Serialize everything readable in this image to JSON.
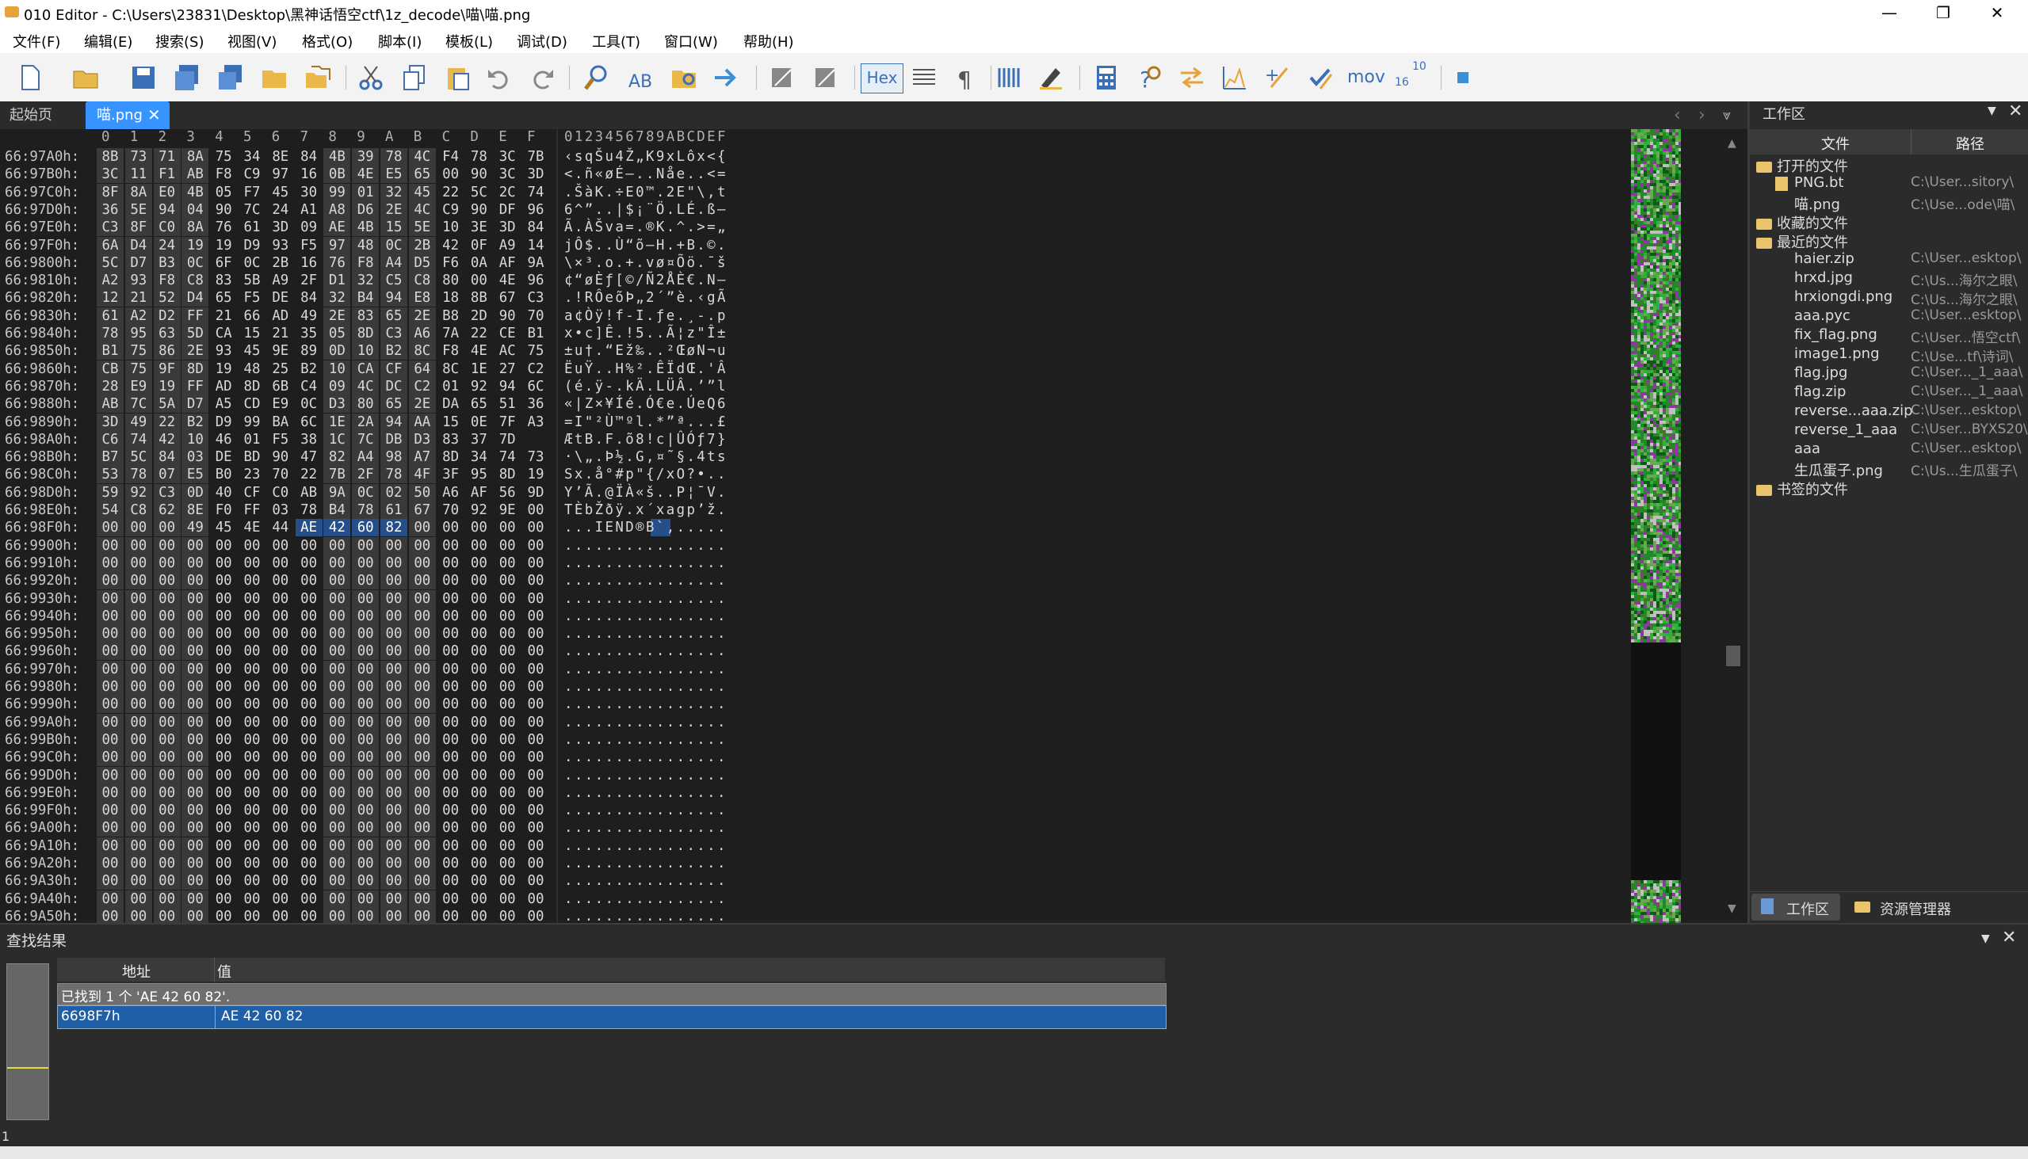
{
  "title": "010 Editor - C:\\Users\\23831\\Desktop\\黑神话悟空ctf\\1z_decode\\喵\\喵.png",
  "window_controls": {
    "minimize": "—",
    "maximize": "❐",
    "close": "✕"
  },
  "menu": [
    "文件(F)",
    "编辑(E)",
    "搜索(S)",
    "视图(V)",
    "格式(O)",
    "脚本(I)",
    "模板(L)",
    "调试(D)",
    "工具(T)",
    "窗口(W)",
    "帮助(H)"
  ],
  "toolbar": {
    "hex_label": "Hex",
    "mov_label": "mov",
    "base_top": "10",
    "base_bottom": "16"
  },
  "tabs": {
    "start": "起始页",
    "file": "喵.png"
  },
  "hex_header": {
    "columns": [
      "0",
      "1",
      "2",
      "3",
      "4",
      "5",
      "6",
      "7",
      "8",
      "9",
      "A",
      "B",
      "C",
      "D",
      "E",
      "F"
    ],
    "ascii": "0123456789ABCDEF"
  },
  "hex_rows": [
    {
      "addr": "66:97A0h:",
      "bytes": [
        "8B",
        "73",
        "71",
        "8A",
        "75",
        "34",
        "8E",
        "84",
        "4B",
        "39",
        "78",
        "4C",
        "F4",
        "78",
        "3C",
        "7B"
      ],
      "ascii": "‹sqŠu4Ž„K9xLôx<{"
    },
    {
      "addr": "66:97B0h:",
      "bytes": [
        "3C",
        "11",
        "F1",
        "AB",
        "F8",
        "C9",
        "97",
        "16",
        "0B",
        "4E",
        "E5",
        "65",
        "00",
        "90",
        "3C",
        "3D"
      ],
      "ascii": "<.ñ«øÉ—..Nåe..<="
    },
    {
      "addr": "66:97C0h:",
      "bytes": [
        "8F",
        "8A",
        "E0",
        "4B",
        "05",
        "F7",
        "45",
        "30",
        "99",
        "01",
        "32",
        "45",
        "22",
        "5C",
        "2C",
        "74"
      ],
      "ascii": ".ŠàK.÷E0™.2E\"\\,t"
    },
    {
      "addr": "66:97D0h:",
      "bytes": [
        "36",
        "5E",
        "94",
        "04",
        "90",
        "7C",
        "24",
        "A1",
        "A8",
        "D6",
        "2E",
        "4C",
        "C9",
        "90",
        "DF",
        "96"
      ],
      "ascii": "6^”..|$¡¨Ö.LÉ.ß–"
    },
    {
      "addr": "66:97E0h:",
      "bytes": [
        "C3",
        "8F",
        "C0",
        "8A",
        "76",
        "61",
        "3D",
        "09",
        "AE",
        "4B",
        "15",
        "5E",
        "10",
        "3E",
        "3D",
        "84"
      ],
      "ascii": "Ã.ÀŠva=.®K.^.>=„"
    },
    {
      "addr": "66:97F0h:",
      "bytes": [
        "6A",
        "D4",
        "24",
        "19",
        "19",
        "D9",
        "93",
        "F5",
        "97",
        "48",
        "0C",
        "2B",
        "42",
        "0F",
        "A9",
        "14"
      ],
      "ascii": "jÔ$..Ù“õ—H.+B.©."
    },
    {
      "addr": "66:9800h:",
      "bytes": [
        "5C",
        "D7",
        "B3",
        "0C",
        "6F",
        "0C",
        "2B",
        "16",
        "76",
        "F8",
        "A4",
        "D5",
        "F6",
        "0A",
        "AF",
        "9A"
      ],
      "ascii": "\\×³.o.+.vø¤Õö.¯š"
    },
    {
      "addr": "66:9810h:",
      "bytes": [
        "A2",
        "93",
        "F8",
        "C8",
        "83",
        "5B",
        "A9",
        "2F",
        "D1",
        "32",
        "C5",
        "C8",
        "80",
        "00",
        "4E",
        "96"
      ],
      "ascii": "¢“øÈƒ[©/Ñ2ÅÈ€.N–"
    },
    {
      "addr": "66:9820h:",
      "bytes": [
        "12",
        "21",
        "52",
        "D4",
        "65",
        "F5",
        "DE",
        "84",
        "32",
        "B4",
        "94",
        "E8",
        "18",
        "8B",
        "67",
        "C3"
      ],
      "ascii": ".!RÔeõÞ„2´”è.‹gÃ"
    },
    {
      "addr": "66:9830h:",
      "bytes": [
        "61",
        "A2",
        "D2",
        "FF",
        "21",
        "66",
        "AD",
        "49",
        "2E",
        "83",
        "65",
        "2E",
        "B8",
        "2D",
        "90",
        "70"
      ],
      "ascii": "a¢Òÿ!f-I.ƒe.¸-.p"
    },
    {
      "addr": "66:9840h:",
      "bytes": [
        "78",
        "95",
        "63",
        "5D",
        "CA",
        "15",
        "21",
        "35",
        "05",
        "8D",
        "C3",
        "A6",
        "7A",
        "22",
        "CE",
        "B1"
      ],
      "ascii": "x•c]Ê.!5..Ã¦z\"Î±"
    },
    {
      "addr": "66:9850h:",
      "bytes": [
        "B1",
        "75",
        "86",
        "2E",
        "93",
        "45",
        "9E",
        "89",
        "0D",
        "10",
        "B2",
        "8C",
        "F8",
        "4E",
        "AC",
        "75"
      ],
      "ascii": "±u†.“Ež‰..²ŒøN¬u"
    },
    {
      "addr": "66:9860h:",
      "bytes": [
        "CB",
        "75",
        "9F",
        "8D",
        "19",
        "48",
        "25",
        "B2",
        "10",
        "CA",
        "CF",
        "64",
        "8C",
        "1E",
        "27",
        "C2"
      ],
      "ascii": "ËuŸ..H%².ÊÏdŒ.'Â"
    },
    {
      "addr": "66:9870h:",
      "bytes": [
        "28",
        "E9",
        "19",
        "FF",
        "AD",
        "8D",
        "6B",
        "C4",
        "09",
        "4C",
        "DC",
        "C2",
        "01",
        "92",
        "94",
        "6C"
      ],
      "ascii": "(é.ÿ-.kÄ.LÜÂ.’”l"
    },
    {
      "addr": "66:9880h:",
      "bytes": [
        "AB",
        "7C",
        "5A",
        "D7",
        "A5",
        "CD",
        "E9",
        "0C",
        "D3",
        "80",
        "65",
        "2E",
        "DA",
        "65",
        "51",
        "36"
      ],
      "ascii": "«|Z×¥Íé.Ó€e.ÚeQ6"
    },
    {
      "addr": "66:9890h:",
      "bytes": [
        "3D",
        "49",
        "22",
        "B2",
        "D9",
        "99",
        "BA",
        "6C",
        "1E",
        "2A",
        "94",
        "AA",
        "15",
        "0E",
        "7F",
        "A3"
      ],
      "ascii": "=I\"²Ù™ºl.*”ª...£"
    },
    {
      "addr": "66:98A0h:",
      "bytes": [
        "C6",
        "74",
        "42",
        "10",
        "46",
        "01",
        "F5",
        "38",
        "1C",
        "7C",
        "DB",
        "D3",
        "83",
        "37",
        "7D",
        ""
      ],
      "ascii": "ÆtB.F.õ8!c|ÛÓƒ7}"
    },
    {
      "addr": "66:98B0h:",
      "bytes": [
        "B7",
        "5C",
        "84",
        "03",
        "DE",
        "BD",
        "90",
        "47",
        "82",
        "A4",
        "98",
        "A7",
        "8D",
        "34",
        "74",
        "73"
      ],
      "ascii": "·\\„.Þ½.G‚¤˜§.4ts"
    },
    {
      "addr": "66:98C0h:",
      "bytes": [
        "53",
        "78",
        "07",
        "E5",
        "B0",
        "23",
        "70",
        "22",
        "7B",
        "2F",
        "78",
        "4F",
        "3F",
        "95",
        "8D",
        "19"
      ],
      "ascii": "Sx.å°#p\"{/xO?•.."
    },
    {
      "addr": "66:98D0h:",
      "bytes": [
        "59",
        "92",
        "C3",
        "0D",
        "40",
        "CF",
        "C0",
        "AB",
        "9A",
        "0C",
        "02",
        "50",
        "A6",
        "AF",
        "56",
        "9D"
      ],
      "ascii": "Y’Ã.@ÏÀ«š..P¦¯V."
    },
    {
      "addr": "66:98E0h:",
      "bytes": [
        "54",
        "C8",
        "62",
        "8E",
        "F0",
        "FF",
        "03",
        "78",
        "B4",
        "78",
        "61",
        "67",
        "70",
        "92",
        "9E",
        "00"
      ],
      "ascii": "TÈbŽðÿ.x´xagp’ž."
    },
    {
      "addr": "66:98F0h:",
      "bytes": [
        "00",
        "00",
        "00",
        "49",
        "45",
        "4E",
        "44",
        "AE",
        "42",
        "60",
        "82",
        "00",
        "00",
        "00",
        "00",
        "00"
      ],
      "ascii": "...IEND®B`‚....."
    },
    {
      "addr": "66:9900h:",
      "bytes": [
        "00",
        "00",
        "00",
        "00",
        "00",
        "00",
        "00",
        "00",
        "00",
        "00",
        "00",
        "00",
        "00",
        "00",
        "00",
        "00"
      ],
      "ascii": "................"
    },
    {
      "addr": "66:9910h:",
      "bytes": [
        "00",
        "00",
        "00",
        "00",
        "00",
        "00",
        "00",
        "00",
        "00",
        "00",
        "00",
        "00",
        "00",
        "00",
        "00",
        "00"
      ],
      "ascii": "................"
    },
    {
      "addr": "66:9920h:",
      "bytes": [
        "00",
        "00",
        "00",
        "00",
        "00",
        "00",
        "00",
        "00",
        "00",
        "00",
        "00",
        "00",
        "00",
        "00",
        "00",
        "00"
      ],
      "ascii": "................"
    },
    {
      "addr": "66:9930h:",
      "bytes": [
        "00",
        "00",
        "00",
        "00",
        "00",
        "00",
        "00",
        "00",
        "00",
        "00",
        "00",
        "00",
        "00",
        "00",
        "00",
        "00"
      ],
      "ascii": "................"
    },
    {
      "addr": "66:9940h:",
      "bytes": [
        "00",
        "00",
        "00",
        "00",
        "00",
        "00",
        "00",
        "00",
        "00",
        "00",
        "00",
        "00",
        "00",
        "00",
        "00",
        "00"
      ],
      "ascii": "................"
    },
    {
      "addr": "66:9950h:",
      "bytes": [
        "00",
        "00",
        "00",
        "00",
        "00",
        "00",
        "00",
        "00",
        "00",
        "00",
        "00",
        "00",
        "00",
        "00",
        "00",
        "00"
      ],
      "ascii": "................"
    },
    {
      "addr": "66:9960h:",
      "bytes": [
        "00",
        "00",
        "00",
        "00",
        "00",
        "00",
        "00",
        "00",
        "00",
        "00",
        "00",
        "00",
        "00",
        "00",
        "00",
        "00"
      ],
      "ascii": "................"
    },
    {
      "addr": "66:9970h:",
      "bytes": [
        "00",
        "00",
        "00",
        "00",
        "00",
        "00",
        "00",
        "00",
        "00",
        "00",
        "00",
        "00",
        "00",
        "00",
        "00",
        "00"
      ],
      "ascii": "................"
    },
    {
      "addr": "66:9980h:",
      "bytes": [
        "00",
        "00",
        "00",
        "00",
        "00",
        "00",
        "00",
        "00",
        "00",
        "00",
        "00",
        "00",
        "00",
        "00",
        "00",
        "00"
      ],
      "ascii": "................"
    },
    {
      "addr": "66:9990h:",
      "bytes": [
        "00",
        "00",
        "00",
        "00",
        "00",
        "00",
        "00",
        "00",
        "00",
        "00",
        "00",
        "00",
        "00",
        "00",
        "00",
        "00"
      ],
      "ascii": "................"
    },
    {
      "addr": "66:99A0h:",
      "bytes": [
        "00",
        "00",
        "00",
        "00",
        "00",
        "00",
        "00",
        "00",
        "00",
        "00",
        "00",
        "00",
        "00",
        "00",
        "00",
        "00"
      ],
      "ascii": "................"
    },
    {
      "addr": "66:99B0h:",
      "bytes": [
        "00",
        "00",
        "00",
        "00",
        "00",
        "00",
        "00",
        "00",
        "00",
        "00",
        "00",
        "00",
        "00",
        "00",
        "00",
        "00"
      ],
      "ascii": "................"
    },
    {
      "addr": "66:99C0h:",
      "bytes": [
        "00",
        "00",
        "00",
        "00",
        "00",
        "00",
        "00",
        "00",
        "00",
        "00",
        "00",
        "00",
        "00",
        "00",
        "00",
        "00"
      ],
      "ascii": "................"
    },
    {
      "addr": "66:99D0h:",
      "bytes": [
        "00",
        "00",
        "00",
        "00",
        "00",
        "00",
        "00",
        "00",
        "00",
        "00",
        "00",
        "00",
        "00",
        "00",
        "00",
        "00"
      ],
      "ascii": "................"
    },
    {
      "addr": "66:99E0h:",
      "bytes": [
        "00",
        "00",
        "00",
        "00",
        "00",
        "00",
        "00",
        "00",
        "00",
        "00",
        "00",
        "00",
        "00",
        "00",
        "00",
        "00"
      ],
      "ascii": "................"
    },
    {
      "addr": "66:99F0h:",
      "bytes": [
        "00",
        "00",
        "00",
        "00",
        "00",
        "00",
        "00",
        "00",
        "00",
        "00",
        "00",
        "00",
        "00",
        "00",
        "00",
        "00"
      ],
      "ascii": "................"
    },
    {
      "addr": "66:9A00h:",
      "bytes": [
        "00",
        "00",
        "00",
        "00",
        "00",
        "00",
        "00",
        "00",
        "00",
        "00",
        "00",
        "00",
        "00",
        "00",
        "00",
        "00"
      ],
      "ascii": "................"
    },
    {
      "addr": "66:9A10h:",
      "bytes": [
        "00",
        "00",
        "00",
        "00",
        "00",
        "00",
        "00",
        "00",
        "00",
        "00",
        "00",
        "00",
        "00",
        "00",
        "00",
        "00"
      ],
      "ascii": "................"
    },
    {
      "addr": "66:9A20h:",
      "bytes": [
        "00",
        "00",
        "00",
        "00",
        "00",
        "00",
        "00",
        "00",
        "00",
        "00",
        "00",
        "00",
        "00",
        "00",
        "00",
        "00"
      ],
      "ascii": "................"
    },
    {
      "addr": "66:9A30h:",
      "bytes": [
        "00",
        "00",
        "00",
        "00",
        "00",
        "00",
        "00",
        "00",
        "00",
        "00",
        "00",
        "00",
        "00",
        "00",
        "00",
        "00"
      ],
      "ascii": "................"
    },
    {
      "addr": "66:9A40h:",
      "bytes": [
        "00",
        "00",
        "00",
        "00",
        "00",
        "00",
        "00",
        "00",
        "00",
        "00",
        "00",
        "00",
        "00",
        "00",
        "00",
        "00"
      ],
      "ascii": "................"
    },
    {
      "addr": "66:9A50h:",
      "bytes": [
        "00",
        "00",
        "00",
        "00",
        "00",
        "00",
        "00",
        "00",
        "00",
        "00",
        "00",
        "00",
        "00",
        "00",
        "00",
        "00"
      ],
      "ascii": "................"
    }
  ],
  "selection": {
    "row": 21,
    "start": 7,
    "end": 10
  },
  "workspace": {
    "title": "工作区",
    "col_file": "文件",
    "col_path": "路径",
    "groups": [
      {
        "label": "打开的文件",
        "items": [
          {
            "name": "PNG.bt",
            "path": "C:\\User...sitory\\"
          },
          {
            "name": "喵.png",
            "path": "C:\\Use...ode\\喵\\"
          }
        ]
      },
      {
        "label": "收藏的文件",
        "items": []
      },
      {
        "label": "最近的文件",
        "items": [
          {
            "name": "haier.zip",
            "path": "C:\\User...esktop\\"
          },
          {
            "name": "hrxd.jpg",
            "path": "C:\\Us...海尔之眼\\"
          },
          {
            "name": "hrxiongdi.png",
            "path": "C:\\Us...海尔之眼\\"
          },
          {
            "name": "aaa.pyc",
            "path": "C:\\User...esktop\\"
          },
          {
            "name": "fix_flag.png",
            "path": "C:\\User...悟空ctf\\"
          },
          {
            "name": "image1.png",
            "path": "C:\\Use...tf\\诗词\\"
          },
          {
            "name": "flag.jpg",
            "path": "C:\\User..._1_aaa\\"
          },
          {
            "name": "flag.zip",
            "path": "C:\\User..._1_aaa\\"
          },
          {
            "name": "reverse...aaa.zip",
            "path": "C:\\User...esktop\\"
          },
          {
            "name": "reverse_1_aaa",
            "path": "C:\\User...BYXS20\\"
          },
          {
            "name": "aaa",
            "path": "C:\\User...esktop\\"
          },
          {
            "name": "生瓜蛋子.png",
            "path": "C:\\Us...生瓜蛋子\\"
          }
        ]
      },
      {
        "label": "书签的文件",
        "items": []
      }
    ],
    "bottom_tabs": [
      "工作区",
      "资源管理器"
    ]
  },
  "find": {
    "title": "查找结果",
    "col_addr": "地址",
    "col_value": "值",
    "summary": "已找到 1 个 'AE 42 60 82'.",
    "result_addr": "6698F7h",
    "result_value": "AE 42 60 82",
    "left_value": "1"
  },
  "colors": {
    "selection": "#264f8a",
    "result_row": "#1f5fa8",
    "accent": "#3794ff"
  }
}
